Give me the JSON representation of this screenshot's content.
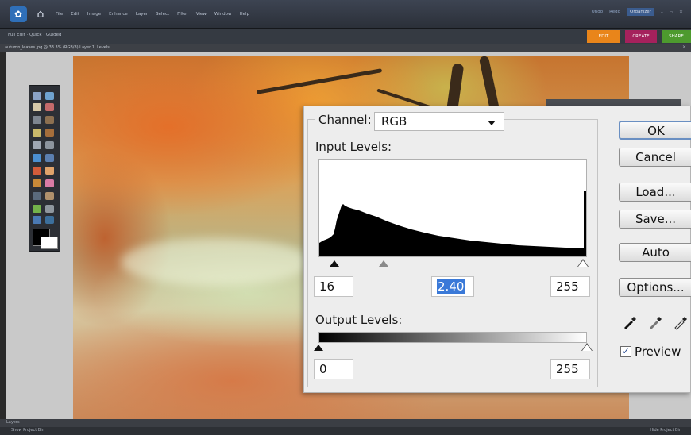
{
  "menubar": {
    "items": [
      "File",
      "Edit",
      "Image",
      "Enhance",
      "Layer",
      "Select",
      "Filter",
      "View",
      "Window",
      "Help"
    ],
    "right": {
      "undo": "Undo",
      "redo": "Redo",
      "organizer": "Organizer"
    }
  },
  "modebar": {
    "text": "Full Edit · Quick · Guided",
    "tabs": {
      "edit": "EDIT",
      "create": "CREATE",
      "share": "SHARE"
    }
  },
  "document": {
    "title": "autumn_leaves.jpg @ 33.3% (RGB/8) Layer 1, Levels"
  },
  "dialog": {
    "channel_label": "Channel:",
    "channel_value": "RGB",
    "input_levels_label": "Input Levels:",
    "input_black": "16",
    "input_gamma": "2.40",
    "input_white": "255",
    "output_levels_label": "Output Levels:",
    "output_black": "0",
    "output_white": "255",
    "buttons": {
      "ok": "OK",
      "cancel": "Cancel",
      "load": "Load...",
      "save": "Save...",
      "auto": "Auto",
      "options": "Options..."
    },
    "preview_label": "Preview",
    "preview_checked": true
  },
  "statusbar": {
    "left": "Layers",
    "left2": "Show Project Bin",
    "right": "Hide Project Bin"
  },
  "colors": {
    "accent_edit": "#e9851a",
    "accent_create": "#a5215c",
    "accent_share": "#4d9a2e"
  }
}
